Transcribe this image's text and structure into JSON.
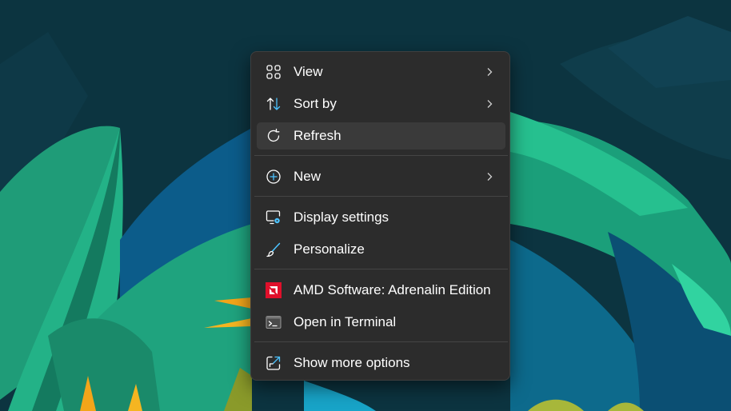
{
  "colors": {
    "menu_bg": "#2c2c2c",
    "hover_bg": "#3a3a3a",
    "text": "#ffffff",
    "separator": "#454545",
    "accent_blue": "#4cc2ff",
    "amd_red": "#e0102b",
    "wallpaper_bg": "#0c3440"
  },
  "context_menu": {
    "items": [
      {
        "label": "View",
        "icon": "grid-icon",
        "submenu": true
      },
      {
        "label": "Sort by",
        "icon": "sort-arrows-icon",
        "submenu": true
      },
      {
        "label": "Refresh",
        "icon": "refresh-icon",
        "submenu": false,
        "highlighted": true
      },
      {
        "label": "New",
        "icon": "plus-circle-icon",
        "submenu": true
      },
      {
        "label": "Display settings",
        "icon": "display-settings-icon",
        "submenu": false
      },
      {
        "label": "Personalize",
        "icon": "paintbrush-icon",
        "submenu": false
      },
      {
        "label": "AMD Software: Adrenalin Edition",
        "icon": "amd-logo-icon",
        "submenu": false
      },
      {
        "label": "Open in Terminal",
        "icon": "terminal-icon",
        "submenu": false
      },
      {
        "label": "Show more options",
        "icon": "share-expand-icon",
        "submenu": false
      }
    ]
  }
}
